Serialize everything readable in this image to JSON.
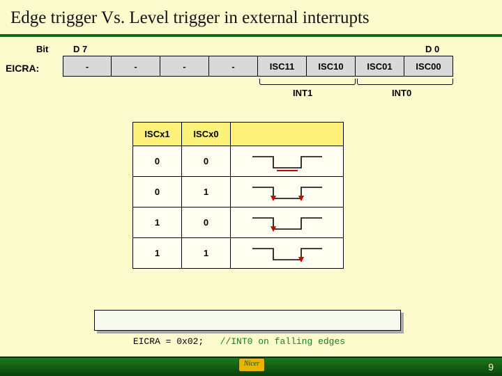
{
  "title": "Edge trigger Vs. Level trigger in external interrupts",
  "bitLabel": "Bit",
  "d7": "D 7",
  "d0": "D 0",
  "regName": "EICRA:",
  "regBits": [
    "-",
    "-",
    "-",
    "-",
    "ISC11",
    "ISC10",
    "ISC01",
    "ISC00"
  ],
  "int1": "INT1",
  "int0": "INT0",
  "table": {
    "headers": [
      "ISCx1",
      "ISCx0"
    ],
    "rows": [
      {
        "a": "0",
        "b": "0",
        "wave": "low"
      },
      {
        "a": "0",
        "b": "1",
        "wave": "any"
      },
      {
        "a": "1",
        "b": "0",
        "wave": "fall"
      },
      {
        "a": "1",
        "b": "1",
        "wave": "rise"
      }
    ]
  },
  "code": {
    "stmt": "EICRA = 0x02;",
    "gap": "   ",
    "comment": "//INT0 on falling edges"
  },
  "footer": {
    "logo": "Nicer",
    "page": "9"
  }
}
